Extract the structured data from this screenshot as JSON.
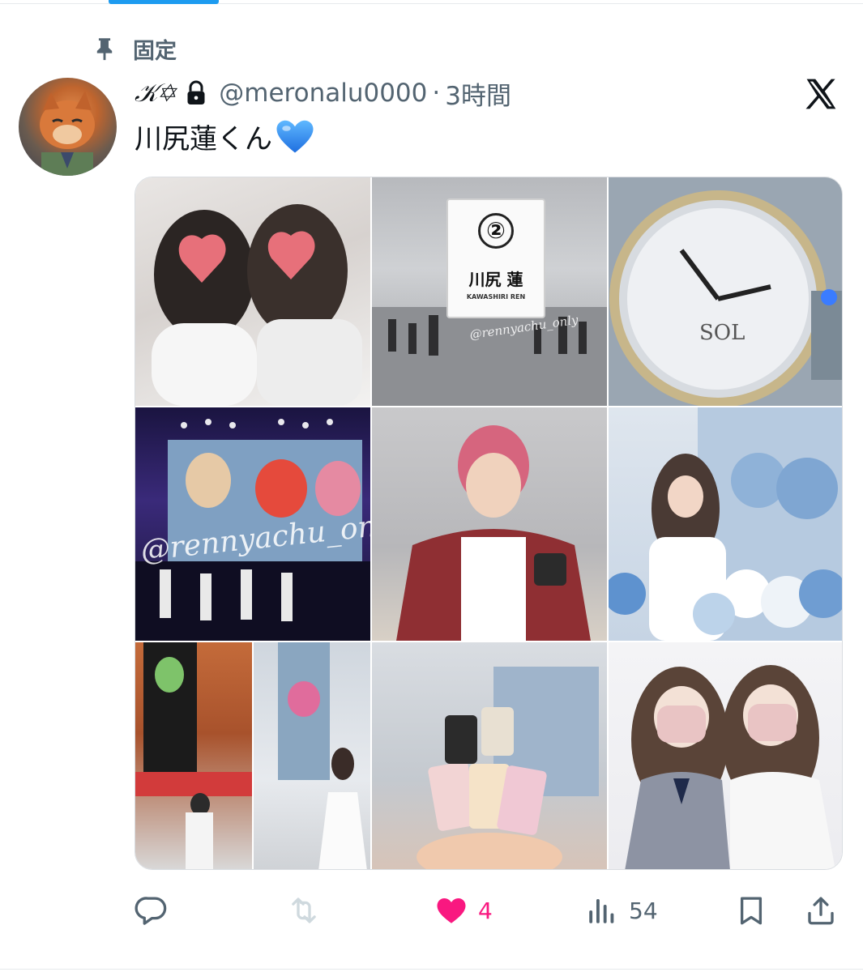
{
  "pinned": {
    "label": "固定",
    "icon": "pin-icon"
  },
  "tweet": {
    "display_name": "𝒦✡",
    "handle": "@meronalu0000",
    "separator": "·",
    "time": "3時間",
    "text": "川尻蓮くん",
    "emoji": "blue-heart-icon",
    "locked_icon": "lock-icon"
  },
  "media": {
    "sign_number": "②",
    "sign_name": "川尻 蓮",
    "sign_roman": "KAWASHIRI REN",
    "watermark_1": "@rennyachu_only",
    "watermark_2": "@rennyachu_only"
  },
  "actions": {
    "reply_count": "",
    "retweet_count": "",
    "like_count": "4",
    "views_count": "54"
  },
  "colors": {
    "accent": "#1d9bf0",
    "like": "#f91880",
    "muted": "#536471",
    "text": "#0f1419"
  }
}
